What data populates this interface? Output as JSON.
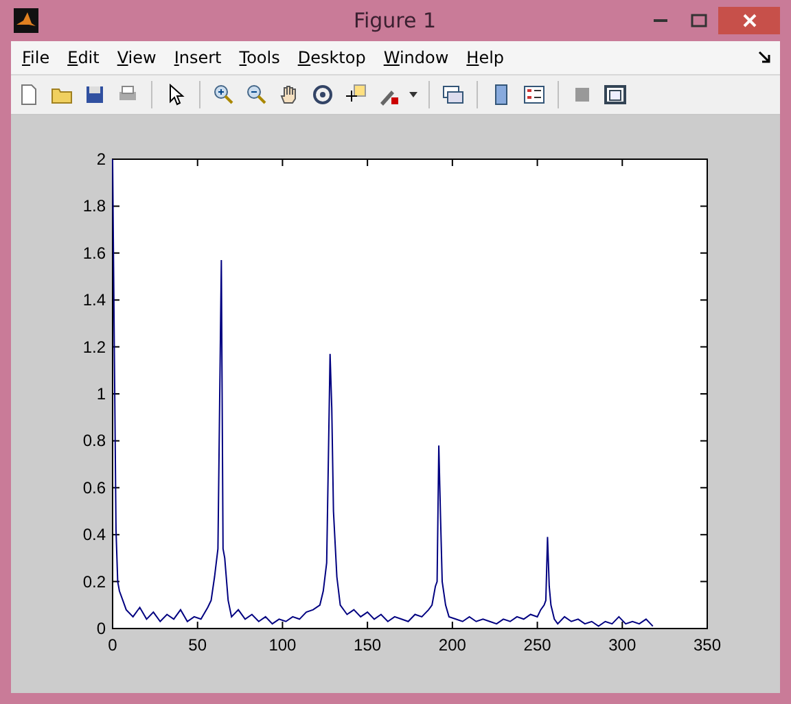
{
  "window": {
    "title": "Figure 1"
  },
  "menu": [
    "File",
    "Edit",
    "View",
    "Insert",
    "Tools",
    "Desktop",
    "Window",
    "Help"
  ],
  "chart_data": {
    "type": "line",
    "xlim": [
      0,
      350
    ],
    "ylim": [
      0,
      2
    ],
    "xticks": [
      0,
      50,
      100,
      150,
      200,
      250,
      300,
      350
    ],
    "yticks": [
      0,
      0.2,
      0.4,
      0.6,
      0.8,
      1,
      1.2,
      1.4,
      1.6,
      1.8,
      2
    ],
    "x": [
      0,
      1,
      2,
      3,
      4,
      6,
      8,
      12,
      16,
      20,
      24,
      28,
      32,
      36,
      40,
      44,
      48,
      52,
      56,
      58,
      60,
      62,
      63,
      64,
      65,
      66,
      68,
      70,
      74,
      78,
      82,
      86,
      90,
      94,
      98,
      102,
      106,
      110,
      114,
      118,
      122,
      124,
      126,
      127,
      128,
      129,
      130,
      132,
      134,
      138,
      142,
      146,
      150,
      154,
      158,
      162,
      166,
      170,
      174,
      178,
      182,
      186,
      188,
      190,
      191,
      192,
      193,
      194,
      196,
      198,
      202,
      206,
      210,
      214,
      218,
      222,
      226,
      230,
      234,
      238,
      242,
      246,
      250,
      252,
      254,
      255,
      256,
      257,
      258,
      260,
      262,
      266,
      270,
      274,
      278,
      282,
      286,
      290,
      294,
      298,
      302,
      306,
      310,
      314,
      318
    ],
    "series": [
      {
        "color": "#000080",
        "values": [
          2,
          1.2,
          0.42,
          0.2,
          0.16,
          0.12,
          0.08,
          0.05,
          0.09,
          0.04,
          0.07,
          0.03,
          0.06,
          0.04,
          0.08,
          0.03,
          0.05,
          0.04,
          0.09,
          0.12,
          0.22,
          0.34,
          0.96,
          1.57,
          0.34,
          0.3,
          0.12,
          0.05,
          0.08,
          0.04,
          0.06,
          0.03,
          0.05,
          0.02,
          0.04,
          0.03,
          0.05,
          0.04,
          0.07,
          0.08,
          0.1,
          0.16,
          0.28,
          0.72,
          1.17,
          0.94,
          0.5,
          0.22,
          0.1,
          0.06,
          0.08,
          0.05,
          0.07,
          0.04,
          0.06,
          0.03,
          0.05,
          0.04,
          0.03,
          0.06,
          0.05,
          0.08,
          0.1,
          0.18,
          0.2,
          0.78,
          0.48,
          0.2,
          0.1,
          0.05,
          0.04,
          0.03,
          0.05,
          0.03,
          0.04,
          0.03,
          0.02,
          0.04,
          0.03,
          0.05,
          0.04,
          0.06,
          0.05,
          0.08,
          0.1,
          0.12,
          0.39,
          0.18,
          0.1,
          0.04,
          0.02,
          0.05,
          0.03,
          0.04,
          0.02,
          0.03,
          0.01,
          0.03,
          0.02,
          0.05,
          0.02,
          0.03,
          0.02,
          0.04,
          0.01
        ]
      }
    ]
  }
}
